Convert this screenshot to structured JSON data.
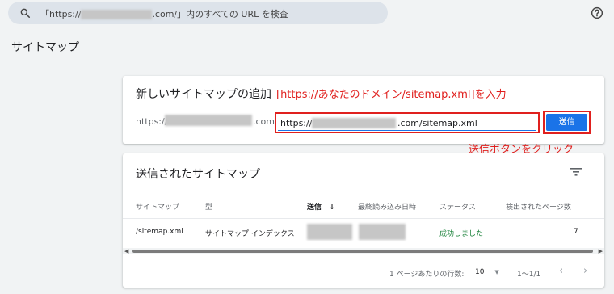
{
  "search": {
    "prefix": "「https://",
    "suffix": ".com/」内のすべての URL を検査"
  },
  "icons": {
    "search": "search-icon",
    "help": "help-icon",
    "filter": "filter-icon",
    "sort": "arrow-down-icon"
  },
  "page": {
    "title": "サイトマップ"
  },
  "add_card": {
    "title": "新しいサイトマップの追加",
    "prefix": "https://",
    "suffix": ".com",
    "input_start": "https://",
    "input_end": ".com/sitemap.xml",
    "submit_label": "送信"
  },
  "annotations": {
    "input_hint": "[https://あなたのドメイン/sitemap.xml]を入力",
    "button_hint": "送信ボタンをクリック",
    "color": "#e0201e"
  },
  "submitted_card": {
    "title": "送信されたサイトマップ",
    "columns": [
      "サイトマップ",
      "型",
      "送信",
      "最終読み込み日時",
      "ステータス",
      "検出されたページ数"
    ],
    "sort_arrow": "↓",
    "rows": [
      {
        "sitemap": "/sitemap.xml",
        "type": "サイトマップ インデックス",
        "status": "成功しました",
        "pages": "7"
      }
    ],
    "pagination": {
      "rows_per_page_label": "1 ページあたりの行数:",
      "rows_per_page": "10",
      "range": "1〜1/1",
      "prev": "‹",
      "next": "›"
    }
  },
  "colors": {
    "accent": "#1a73e8",
    "success": "#188038"
  }
}
